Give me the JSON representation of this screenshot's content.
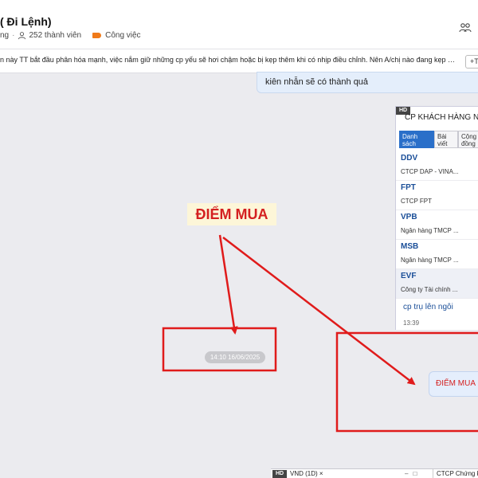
{
  "header": {
    "title": "( Đi Lệnh)",
    "status_fragment": "ng",
    "separator": "·",
    "members": "252 thành viên",
    "category": "Công việc",
    "icons": {
      "members": "person-icon",
      "category": "tag-icon",
      "group": "group-icon"
    }
  },
  "pinned": {
    "text": "n này TT bắt đầu phân hóa mạnh, việc nắm giữ những cp yếu sẽ hơi chậm hoặc bị kẹp thêm khi có nhịp điều chỉnh. Nên A/chị nào đang kẹp hàng thì...",
    "button_label": "+T"
  },
  "message_top": {
    "text": "kiên nhẫn sẽ có thành quả"
  },
  "stock_card": {
    "badge": "HD",
    "title": "CP KHÁCH HÀNG N",
    "tabs": [
      {
        "label": "Danh sách"
      },
      {
        "label": "Bài viết"
      },
      {
        "label": "Cộng đồng"
      }
    ],
    "items": [
      {
        "code": "DDV",
        "name": "CTCP DAP - VINA..."
      },
      {
        "code": "FPT",
        "name": "CTCP FPT"
      },
      {
        "code": "VPB",
        "name": "Ngân hàng TMCP ..."
      },
      {
        "code": "MSB",
        "name": "Ngân hàng TMCP ..."
      },
      {
        "code": "EVF",
        "name": "Công ty Tài chính ..."
      }
    ],
    "footer_text": "cp trụ lên ngôi",
    "footer_time": "13:39"
  },
  "annotation": {
    "label": "ĐIỂM MUA",
    "color": "#e01b1b"
  },
  "timestamp": "14:10 16/06/2025",
  "reply_bubble": {
    "text": "ĐIỂM MUA I"
  },
  "bottom_bar": {
    "badge": "HD",
    "tab1": "VND (1D) ×",
    "controls": "– □",
    "tab2": "CTCP Chứng kh..."
  }
}
